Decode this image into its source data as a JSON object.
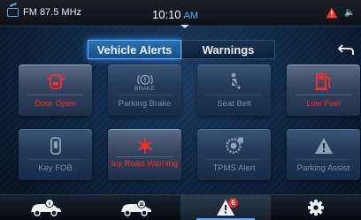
{
  "status": {
    "radio": "FM 87.5 MHz",
    "time": "10:10",
    "ampm": "AM"
  },
  "tabs": [
    {
      "label": "Vehicle Alerts",
      "active": true
    },
    {
      "label": "Warnings",
      "active": false
    }
  ],
  "tiles": [
    {
      "label": "Door Open",
      "icon": "door-open-icon",
      "active": true
    },
    {
      "label": "Parking Brake",
      "icon": "parking-brake-icon",
      "active": false,
      "sub": "BRAKE"
    },
    {
      "label": "Seat Belt",
      "icon": "seatbelt-icon",
      "active": false
    },
    {
      "label": "Low Fuel",
      "icon": "fuel-pump-icon",
      "active": true
    },
    {
      "label": "Key FOB",
      "icon": "key-fob-icon",
      "active": false
    },
    {
      "label": "Icy Road Warning",
      "icon": "snowflake-icon",
      "active": true
    },
    {
      "label": "TPMS Alert",
      "icon": "tire-pressure-icon",
      "active": false
    },
    {
      "label": "Parking Assist",
      "icon": "warning-triangle-icon",
      "active": false
    }
  ],
  "nav": [
    {
      "icon": "car-info-icon"
    },
    {
      "icon": "car-menu-icon"
    },
    {
      "icon": "alert-icon",
      "badge": "6",
      "active": true
    },
    {
      "icon": "gear-icon"
    }
  ],
  "colors": {
    "accent": "#4fa6ff",
    "alert_red": "#ff2a2a",
    "inactive_text": "#7b8ea6"
  }
}
